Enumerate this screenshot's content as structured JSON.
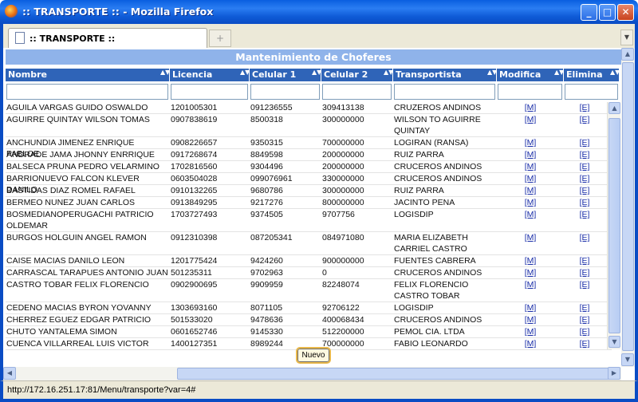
{
  "window": {
    "title": ":: TRANSPORTE :: - Mozilla Firefox",
    "min_symbol": "_",
    "max_symbol": "□",
    "close_symbol": "✕"
  },
  "tabs": [
    {
      "label": ":: TRANSPORTE ::"
    }
  ],
  "newtab_symbol": "+",
  "tablist_symbol": "▼",
  "page": {
    "header": "Mantenimiento de Choferes",
    "columns": [
      "Nombre",
      "Licencia",
      "Celular 1",
      "Celular 2",
      "Transportista",
      "Modifica",
      "Elimina"
    ],
    "sort_symbol": "▲▼",
    "new_button": "Nuevo",
    "modify_link": "[M]",
    "delete_link": "[E]"
  },
  "rows": [
    [
      "AGUILA VARGAS GUIDO OSWALDO",
      "1201005301",
      "091236555",
      "309413138",
      "CRUZEROS ANDINOS"
    ],
    [
      "AGUIRRE QUINTAY WILSON TOMAS",
      "0907838619",
      "8500318",
      "300000000",
      "WILSON TO AGUIRRE QUINTAY"
    ],
    [
      "ANCHUNDIA JIMENEZ ENRIQUE PABLOE",
      "0908226657",
      "9350315",
      "700000000",
      "LOGIRAN (RANSA)"
    ],
    [
      "ANDRADE JAMA JHONNY ENRRIQUE",
      "0917268674",
      "8849598",
      "200000000",
      "RUIZ PARRA"
    ],
    [
      "BALSECA PRUNA PEDRO VELARMINO",
      "1702816560",
      "9304496",
      "200000000",
      "CRUCEROS ANDINOS"
    ],
    [
      "BARRIONUEVO FALCON KLEVER DANILO",
      "0603504028",
      "099076961",
      "330000000",
      "CRUCEROS ANDINOS"
    ],
    [
      "BASTIDAS DIAZ ROMEL RAFAEL",
      "0910132265",
      "9680786",
      "300000000",
      "RUIZ PARRA"
    ],
    [
      "BERMEO NUNEZ JUAN CARLOS",
      "0913849295",
      "9217276",
      "800000000",
      "JACINTO PENA"
    ],
    [
      "BOSMEDIANOPERUGACHI PATRICIO OLDEMAR",
      "1703727493",
      "9374505",
      "9707756",
      "LOGISDIP"
    ],
    [
      "BURGOS HOLGUIN ANGEL RAMON",
      "0912310398",
      "087205341",
      "084971080",
      "MARIA ELIZABETH CARRIEL CASTRO"
    ],
    [
      "CAISE MACIAS DANILO LEON",
      "1201775424",
      "9424260",
      "900000000",
      "FUENTES CABRERA"
    ],
    [
      "CARRASCAL TARAPUES ANTONIO JUAN",
      "501235311",
      "9702963",
      "0",
      "CRUCEROS ANDINOS"
    ],
    [
      "CASTRO TOBAR FELIX FLORENCIO",
      "0902900695",
      "9909959",
      "82248074",
      "FELIX FLORENCIO CASTRO TOBAR"
    ],
    [
      "CEDENO MACIAS BYRON YOVANNY",
      "1303693160",
      "8071105",
      "92706122",
      "LOGISDIP"
    ],
    [
      "CHERREZ EGUEZ EDGAR PATRICIO",
      "501533020",
      "9478636",
      "400068434",
      "CRUCEROS ANDINOS"
    ],
    [
      "CHUTO YANTALEMA SIMON",
      "0601652746",
      "9145330",
      "512200000",
      "PEMOL CIA. LTDA"
    ],
    [
      "CUENCA VILLARREAL LUIS VICTOR",
      "1400127351",
      "8989244",
      "700000000",
      "FABIO LEONARDO"
    ]
  ],
  "status": {
    "text": "http://172.16.251.17:81/Menu/transporte?var=4#"
  },
  "scroll": {
    "up": "▲",
    "down": "▼",
    "left": "◀",
    "right": "▶"
  }
}
